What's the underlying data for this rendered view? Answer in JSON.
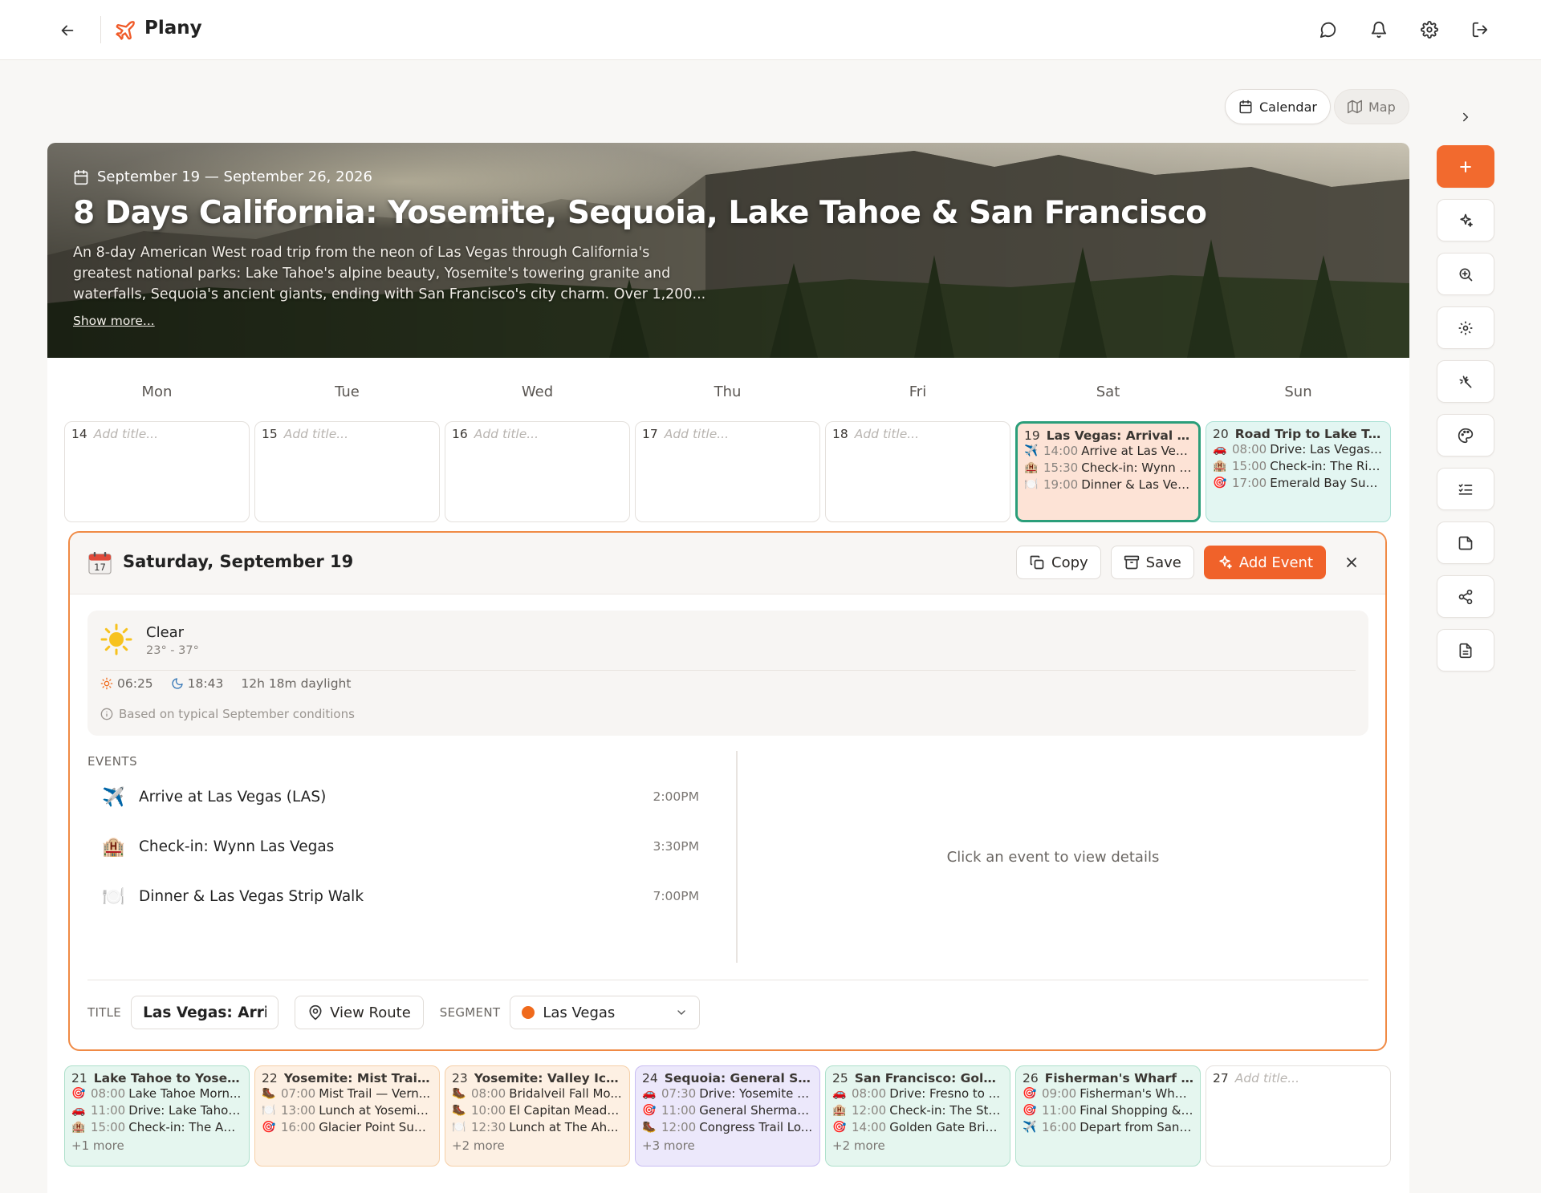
{
  "app": {
    "name": "Plany"
  },
  "view": {
    "calendar_label": "Calendar",
    "map_label": "Map"
  },
  "trip": {
    "date_range": "September 19 — September 26, 2026",
    "title": "8 Days California: Yosemite, Sequoia, Lake Tahoe & San Francisco",
    "description": "An 8-day American West road trip from the neon of Las Vegas through California's greatest national parks: Lake Tahoe's alpine beauty, Yosemite's towering granite and waterfalls, Sequoia's ancient giants, ending with San Francisco's city charm. Over 1,200...",
    "show_more": "Show more..."
  },
  "weekdays": [
    "Mon",
    "Tue",
    "Wed",
    "Thu",
    "Fri",
    "Sat",
    "Sun"
  ],
  "week1": [
    {
      "num": "14",
      "placeholder": "Add title..."
    },
    {
      "num": "15",
      "placeholder": "Add title..."
    },
    {
      "num": "16",
      "placeholder": "Add title..."
    },
    {
      "num": "17",
      "placeholder": "Add title..."
    },
    {
      "num": "18",
      "placeholder": "Add title..."
    },
    {
      "num": "19",
      "title": "Las Vegas: Arrival & T...",
      "events": [
        {
          "icon": "✈️",
          "time": "14:00",
          "name": "Arrive at Las Veg..."
        },
        {
          "icon": "🏨",
          "time": "15:30",
          "name": "Check-in: Wynn L..."
        },
        {
          "icon": "🍽️",
          "time": "19:00",
          "name": "Dinner & Las Veg..."
        }
      ]
    },
    {
      "num": "20",
      "title": "Road Trip to Lake Tah...",
      "events": [
        {
          "icon": "🚗",
          "time": "08:00",
          "name": "Drive: Las Vegas ..."
        },
        {
          "icon": "🏨",
          "time": "15:00",
          "name": "Check-in: The Rit..."
        },
        {
          "icon": "🎯",
          "time": "17:00",
          "name": "Emerald Bay Suns..."
        }
      ]
    }
  ],
  "week2": [
    {
      "num": "21",
      "title": "Lake Tahoe to Yosemit...",
      "more": "+1 more",
      "events": [
        {
          "icon": "🎯",
          "time": "08:00",
          "name": "Lake Tahoe Morn..."
        },
        {
          "icon": "🚗",
          "time": "11:00",
          "name": "Drive: Lake Tahoe ..."
        },
        {
          "icon": "🏨",
          "time": "15:00",
          "name": "Check-in: The Ah..."
        }
      ]
    },
    {
      "num": "22",
      "title": "Yosemite: Mist Trail & ...",
      "events": [
        {
          "icon": "🥾",
          "time": "07:00",
          "name": "Mist Trail — Vern..."
        },
        {
          "icon": "🍽️",
          "time": "13:00",
          "name": "Lunch at Yosemit..."
        },
        {
          "icon": "🎯",
          "time": "16:00",
          "name": "Glacier Point Sun..."
        }
      ]
    },
    {
      "num": "23",
      "title": "Yosemite: Valley Icon...",
      "more": "+2 more",
      "events": [
        {
          "icon": "🥾",
          "time": "08:00",
          "name": "Bridalveil Fall Mo..."
        },
        {
          "icon": "🥾",
          "time": "10:00",
          "name": "El Capitan Meado..."
        },
        {
          "icon": "🍽️",
          "time": "12:30",
          "name": "Lunch at The Ah..."
        }
      ]
    },
    {
      "num": "24",
      "title": "Sequoia: General She...",
      "more": "+3 more",
      "events": [
        {
          "icon": "🚗",
          "time": "07:30",
          "name": "Drive: Yosemite t..."
        },
        {
          "icon": "🎯",
          "time": "11:00",
          "name": "General Sherman ..."
        },
        {
          "icon": "🥾",
          "time": "12:00",
          "name": "Congress Trail Lo..."
        }
      ]
    },
    {
      "num": "25",
      "title": "San Francisco: Golde...",
      "more": "+2 more",
      "events": [
        {
          "icon": "🚗",
          "time": "08:00",
          "name": "Drive: Fresno to ..."
        },
        {
          "icon": "🏨",
          "time": "12:00",
          "name": "Check-in: The St. ..."
        },
        {
          "icon": "🎯",
          "time": "14:00",
          "name": "Golden Gate Brid..."
        }
      ]
    },
    {
      "num": "26",
      "title": "Fisherman's Wharf & ...",
      "events": [
        {
          "icon": "🎯",
          "time": "09:00",
          "name": "Fisherman's Wha..."
        },
        {
          "icon": "🎯",
          "time": "11:00",
          "name": "Final Shopping & ..."
        },
        {
          "icon": "✈️",
          "time": "16:00",
          "name": "Depart from San ..."
        }
      ]
    },
    {
      "num": "27",
      "placeholder": "Add title..."
    }
  ],
  "detail": {
    "date_title": "Saturday, September 19",
    "copy_label": "Copy",
    "save_label": "Save",
    "add_event_label": "Add Event",
    "weather": {
      "condition": "Clear",
      "range": "23° - 37°",
      "sunrise": "06:25",
      "sunset": "18:43",
      "daylight": "12h 18m daylight",
      "note": "Based on typical September conditions"
    },
    "events_label": "EVENTS",
    "events": [
      {
        "icon": "✈️",
        "name": "Arrive at Las Vegas (LAS)",
        "time": "2:00PM"
      },
      {
        "icon": "🏨",
        "name": "Check-in: Wynn Las Vegas",
        "time": "3:30PM"
      },
      {
        "icon": "🍽️",
        "name": "Dinner & Las Vegas Strip Walk",
        "time": "7:00PM"
      }
    ],
    "empty_text": "Click an event to view details",
    "title_label": "TITLE",
    "title_value": "Las Vegas: Arrival & T",
    "view_route_label": "View Route",
    "segment_label": "SEGMENT",
    "segment_value": "Las Vegas"
  },
  "colors": {
    "accent": "#f0622a",
    "selected_border": "#f08a45"
  }
}
